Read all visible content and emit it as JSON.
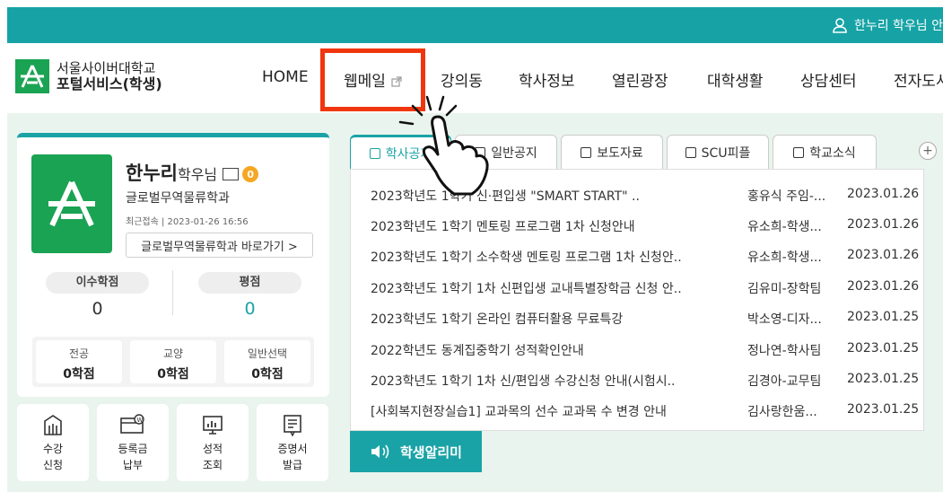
{
  "topbar": {
    "user_text": "한누리 학우님 안"
  },
  "logo": {
    "line1": "서울사이버대학교",
    "line2": "포털서비스(학생)"
  },
  "nav": {
    "items": [
      "HOME",
      "웹메일",
      "강의동",
      "학사정보",
      "열린광장",
      "대학생활",
      "상담센터",
      "전자도서"
    ]
  },
  "profile": {
    "name": "한누리",
    "name_suffix": "학우님",
    "mail_count": "0",
    "department": "글로벌무역물류학과",
    "last_login": "최근접속 | 2023-01-26 16:56",
    "dept_link": "글로벌무역물류학과 바로가기 >",
    "stats": [
      {
        "label": "이수학점",
        "value": "0"
      },
      {
        "label": "평점",
        "value": "0"
      }
    ],
    "credits": [
      {
        "label": "전공",
        "value": "0학점"
      },
      {
        "label": "교양",
        "value": "0학점"
      },
      {
        "label": "일반선택",
        "value": "0학점"
      }
    ]
  },
  "quicklinks": [
    {
      "line1": "수강",
      "line2": "신청",
      "icon": "course-icon"
    },
    {
      "line1": "등록금",
      "line2": "납부",
      "icon": "tuition-icon"
    },
    {
      "line1": "성적",
      "line2": "조회",
      "icon": "grade-icon"
    },
    {
      "line1": "증명서",
      "line2": "발급",
      "icon": "certificate-icon"
    }
  ],
  "notice": {
    "tabs": [
      "학사공지",
      "일반공지",
      "보도자료",
      "SCU피플",
      "학교소식"
    ],
    "more": "+",
    "rows": [
      {
        "title": "2023학년도 1학기 신·편입생 \"SMART START\" ..",
        "author": "홍유식 주임-...",
        "date": "2023.01.26"
      },
      {
        "title": "2023학년도 1학기 멘토링 프로그램 1차 신청안내",
        "author": "유소희-학생...",
        "date": "2023.01.26"
      },
      {
        "title": "2023학년도 1학기 소수학생 멘토링 프로그램 1차 신청안..",
        "author": "유소희-학생...",
        "date": "2023.01.26"
      },
      {
        "title": "2023학년도 1학기 1차 신편입생 교내특별장학금 신청 안..",
        "author": "김유미-장학팀",
        "date": "2023.01.26"
      },
      {
        "title": "2023학년도 1학기 온라인 컴퓨터활용 무료특강",
        "author": "박소영-디자...",
        "date": "2023.01.25"
      },
      {
        "title": "2022학년도 동계집중학기 성적확인안내",
        "author": "정나연-학사팀",
        "date": "2023.01.25"
      },
      {
        "title": "2023학년도 1학기 1차 신/편입생 수강신청 안내(시험시..",
        "author": "김경아-교무팀",
        "date": "2023.01.25"
      },
      {
        "title": "[사회복지현장실습1] 교과목의 선수 교과목 수 변경 안내",
        "author": "김사랑한움...",
        "date": "2023.01.25"
      }
    ],
    "alarm_label": "학생알리미"
  },
  "colors": {
    "teal": "#1aa3a6",
    "green": "#1aa353",
    "highlight": "#f0360e",
    "badge": "#f5a623"
  }
}
